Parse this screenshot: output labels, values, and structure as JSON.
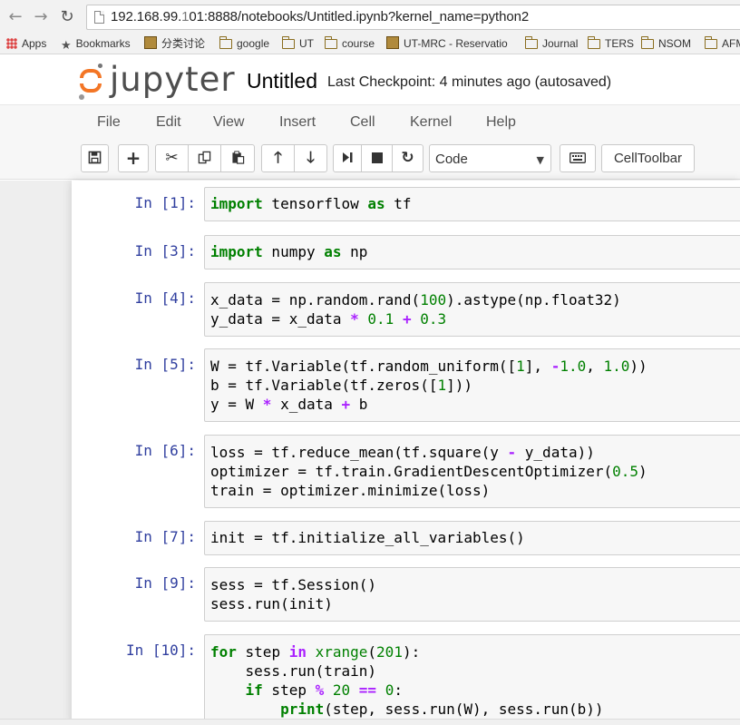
{
  "browser": {
    "url_host": "192.168.99.",
    "url_host_hidden": "1",
    "url_rest": "01:8888/notebooks/Untitled.ipynb?kernel_name=python2",
    "bookmarks": [
      "Apps",
      "Bookmarks",
      "分类讨论",
      "google",
      "UT",
      "course",
      "UT-MRC - Reservatio",
      "Journal",
      "TERS",
      "NSOM",
      "AFM"
    ]
  },
  "header": {
    "logo_text": "jupyter",
    "title": "Untitled",
    "checkpoint": "Last Checkpoint: 4 minutes ago (autosaved)"
  },
  "menu": [
    "File",
    "Edit",
    "View",
    "Insert",
    "Cell",
    "Kernel",
    "Help"
  ],
  "toolbar": {
    "cell_type": "Code",
    "celltoolbar_label": "CellToolbar"
  },
  "cells": [
    {
      "prompt": "In [1]:",
      "lines": [
        "import tensorflow as tf"
      ]
    },
    {
      "prompt": "In [3]:",
      "lines": [
        "import numpy as np"
      ]
    },
    {
      "prompt": "In [4]:",
      "lines": [
        "x_data = np.random.rand(100).astype(np.float32)",
        "y_data = x_data * 0.1 + 0.3"
      ]
    },
    {
      "prompt": "In [5]:",
      "lines": [
        "W = tf.Variable(tf.random_uniform([1], -1.0, 1.0))",
        "b = tf.Variable(tf.zeros([1]))",
        "y = W * x_data + b"
      ]
    },
    {
      "prompt": "In [6]:",
      "lines": [
        "loss = tf.reduce_mean(tf.square(y - y_data))",
        "optimizer = tf.train.GradientDescentOptimizer(0.5)",
        "train = optimizer.minimize(loss)"
      ]
    },
    {
      "prompt": "In [7]:",
      "lines": [
        "init = tf.initialize_all_variables()"
      ]
    },
    {
      "prompt": "In [9]:",
      "lines": [
        "sess = tf.Session()",
        "sess.run(init)"
      ]
    },
    {
      "prompt": "In [10]:",
      "lines": [
        "for step in xrange(201):",
        "    sess.run(train)",
        "    if step % 20 == 0:",
        "        print(step, sess.run(W), sess.run(b))"
      ]
    }
  ]
}
